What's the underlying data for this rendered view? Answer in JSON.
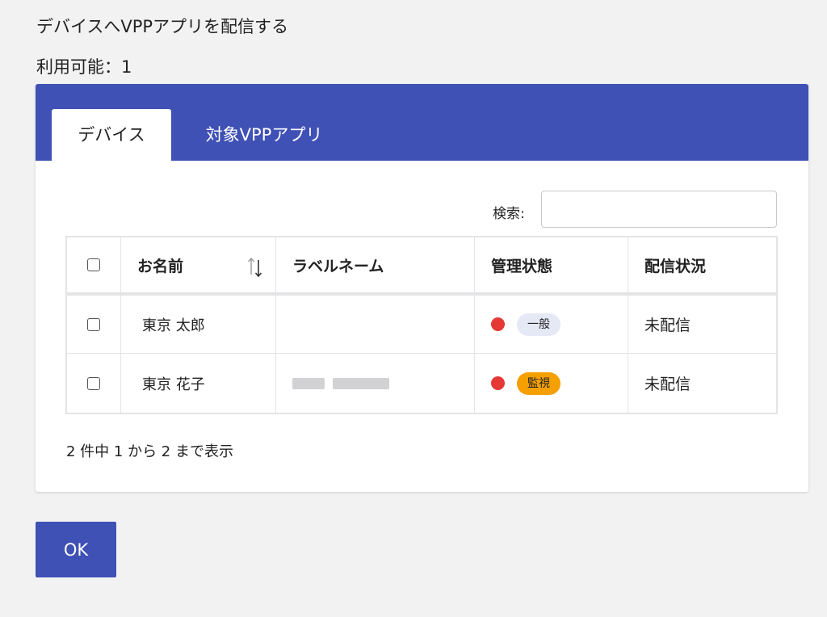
{
  "header": {
    "title": "デバイスへVPPアプリを配信する",
    "available_label": "利用可能：1"
  },
  "tabs": [
    {
      "label": "デバイス",
      "active": true
    },
    {
      "label": "対象VPPアプリ",
      "active": false
    }
  ],
  "search": {
    "label": "検索:",
    "value": ""
  },
  "table": {
    "columns": [
      "お名前",
      "ラベルネーム",
      "管理状態",
      "配信状況"
    ],
    "rows": [
      {
        "name": "東京 太郎",
        "label_name": "",
        "management_state": "一般",
        "delivery_status": "未配信"
      },
      {
        "name": "東京 花子",
        "label_name": "",
        "management_state": "監視",
        "delivery_status": "未配信"
      }
    ]
  },
  "pager": {
    "info": "2 件中 1 から 2 まで表示"
  },
  "footer": {
    "ok_label": "OK"
  },
  "colors": {
    "primary": "#3f51b5",
    "status_dot": "#e53935",
    "badge_general": "#e5e8f5",
    "badge_supervised": "#f59f00"
  }
}
